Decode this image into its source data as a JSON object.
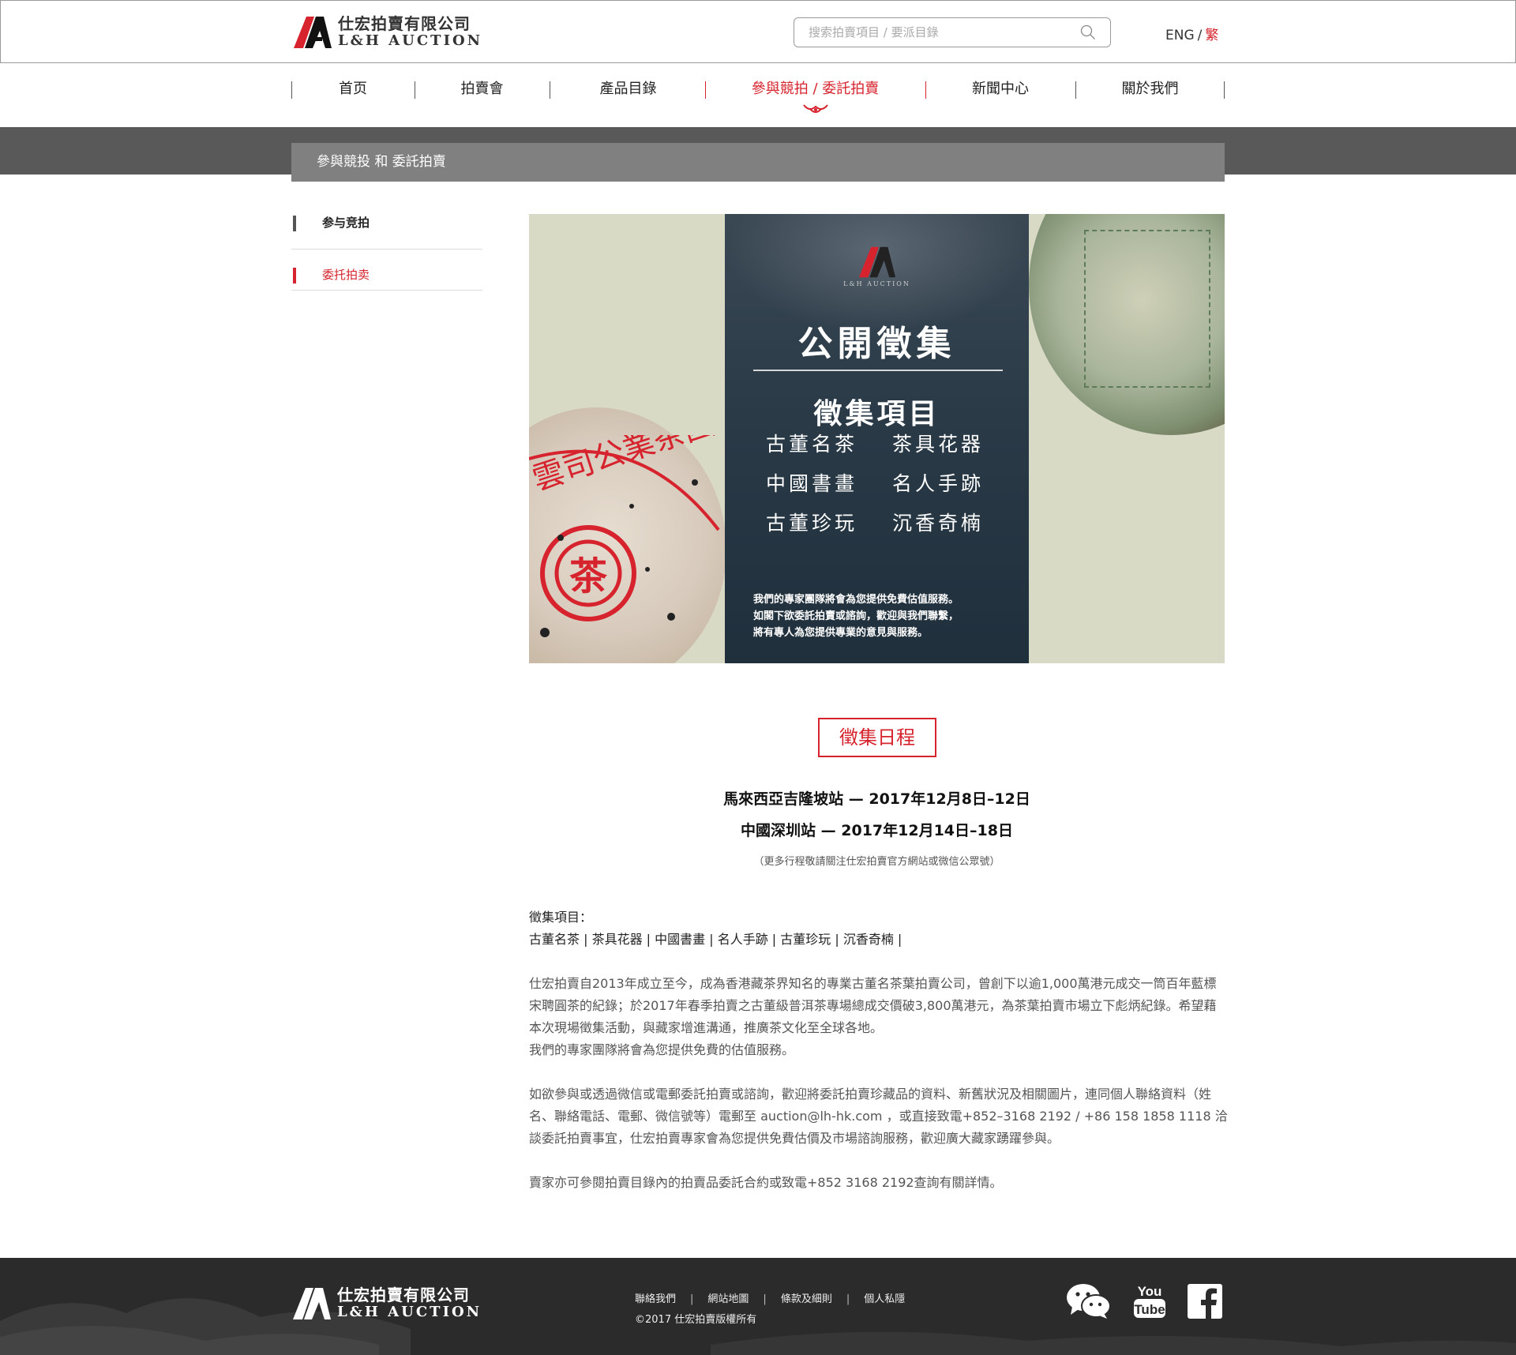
{
  "header": {
    "logo": {
      "cn": "仕宏拍賣有限公司",
      "en": "L&H AUCTION"
    },
    "search_placeholder": "搜索拍賣項目 / 要派目錄",
    "lang": {
      "eng": "ENG",
      "sep": "/",
      "trad": "繁"
    }
  },
  "nav": [
    {
      "label": "首页"
    },
    {
      "label": "拍賣會"
    },
    {
      "label": "產品目錄"
    },
    {
      "label": "參與競拍 / 委託拍賣"
    },
    {
      "label": "新聞中心"
    },
    {
      "label": "關於我們"
    }
  ],
  "page_title": "參與競投 和 委託拍賣",
  "sidebar": [
    {
      "label": "参与竞拍"
    },
    {
      "label": "委托拍卖"
    }
  ],
  "poster": {
    "logo_text": "L&H AUCTION",
    "title": "公開徵集",
    "subtitle": "徵集項目",
    "items": [
      "古董名茶",
      "茶具花器",
      "中國書畫",
      "名人手跡",
      "古董珍玩",
      "沉香奇楠"
    ],
    "note": [
      "我們的專家團隊將會為您提供免費估值服務。",
      "如閣下欲委託拍賣或諮詢，歡迎與我們聯繫，",
      "將有專人為您提供專業的意見與服務。"
    ]
  },
  "schedule": {
    "heading": "徵集日程",
    "lines": [
      "馬來西亞吉隆坡站 — 2017年12月8日–12日",
      "中國深圳站 — 2017年12月14日–18日"
    ],
    "note": "（更多行程敬請關注仕宏拍賣官方網站或微信公眾號）"
  },
  "content": {
    "items_label": "徵集項目：",
    "items_list": "古董名茶 | 茶具花器 | 中國書畫 | 名人手跡 | 古董珍玩 | 沉香奇楠 |",
    "para1": "仕宏拍賣自2013年成立至今，成為香港藏茶界知名的專業古董名茶葉拍賣公司，曾創下以逾1,000萬港元成交一筒百年藍標宋聘圓茶的紀錄；於2017年春季拍賣之古董級普洱茶專場總成交價破3,800萬港元，為茶葉拍賣市場立下彪炳紀錄。希望藉本次現場徵集活動，與藏家增進溝通，推廣茶文化至全球各地。",
    "para1b": "我們的專家團隊將會為您提供免費的估值服務。",
    "para2": "如欲參與或透過微信或電郵委託拍賣或諮詢，歡迎將委託拍賣珍藏品的資料、新舊狀況及相關圖片，連同個人聯絡資料（姓名、聯絡電話、電郵、微信號等）電郵至 auction@lh-hk.com ，或直接致電+852–3168 2192 / +86 158 1858 1118 洽談委託拍賣事宜，仕宏拍賣專家會為您提供免費估價及市場諮詢服務，歡迎廣大藏家踴躍參與。",
    "para3": "賣家亦可參閱拍賣目錄內的拍賣品委託合約或致電+852 3168 2192查詢有關詳情。"
  },
  "footer": {
    "logo": {
      "cn": "仕宏拍賣有限公司",
      "en": "L&H AUCTION"
    },
    "links": [
      "聯絡我們",
      "網站地圖",
      "條款及細則",
      "個人私隱"
    ],
    "sep": "|",
    "copyright": "©2017 仕宏拍賣版權所有",
    "social": [
      "wechat-icon",
      "youtube-icon",
      "facebook-icon"
    ],
    "youtube_top": "You",
    "youtube_bottom": "Tube"
  },
  "colors": {
    "accent": "#d6232d",
    "dark": "#595959",
    "band": "#808080",
    "footer": "#2b2b2b"
  }
}
